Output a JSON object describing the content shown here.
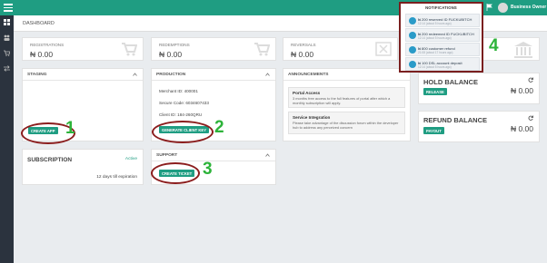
{
  "header": {
    "owner_name": "Business Owner"
  },
  "page": {
    "title": "DASHBOARD"
  },
  "stats": [
    {
      "label": "REGISTRATIONS",
      "value": "₦ 0.00",
      "icon": "cart-icon"
    },
    {
      "label": "REDEMPTIONS",
      "value": "₦ 0.00",
      "icon": "cart-icon"
    },
    {
      "label": "REVERSALS",
      "value": "₦ 0.00",
      "icon": "cancel-icon"
    }
  ],
  "staging": {
    "title": "STAGING",
    "create_app": "CREATE APP"
  },
  "production": {
    "title": "PRODUCTION",
    "merchant_id": "Merchant ID: 400001",
    "secure_code": "Secure Code: 6034607433",
    "client_id": "Client ID: 184-260QRU",
    "generate_key": "GENERATE CLIENT KEY"
  },
  "subscription": {
    "title": "SUBSCRIPTION",
    "status": "Active",
    "expiry": "12 days till expiration"
  },
  "support": {
    "title": "SUPPORT",
    "create_ticket": "CREATE TICKET"
  },
  "announcements": {
    "title": "ANNOUNCEMENTS",
    "items": [
      {
        "title": "Portal Access",
        "text": "3 months free access to the full features of portal after which a monthly subscription will apply."
      },
      {
        "title": "Service Integration",
        "text": "Please take advantage of the discussion forum within the developer hub to address any perceived concern"
      }
    ]
  },
  "hold_balance": {
    "title": "HOLD BALANCE",
    "button": "RELEASE",
    "value": "₦ 0.00"
  },
  "refund_balance": {
    "title": "REFUND BALANCE",
    "button": "PAYOUT",
    "value": "₦ 0.00"
  },
  "notifications": {
    "title": "NOTIFICATIONS",
    "items": [
      {
        "text": "₦ 200 reserved ID FUCKUBITCH",
        "time": "12:14 (about 5 hours ago)"
      },
      {
        "text": "₦ 200 redeemed ID FUCKUBITCH",
        "time": "12:14 (about 5 hours ago)"
      },
      {
        "text": "₦ 800 customer refund",
        "time": "21:08 (about 17 hours ago)"
      },
      {
        "text": "₦ 100 DSL account deposit",
        "time": "12:14 (about 5 hours ago)"
      }
    ]
  },
  "annotations": {
    "one": "1",
    "two": "2",
    "three": "3",
    "four": "4"
  },
  "colors": {
    "brand": "#1f9d82",
    "sidebar": "#2b333e",
    "annotation_ring": "#8b1d1d",
    "annotation_number": "#2db33a"
  }
}
